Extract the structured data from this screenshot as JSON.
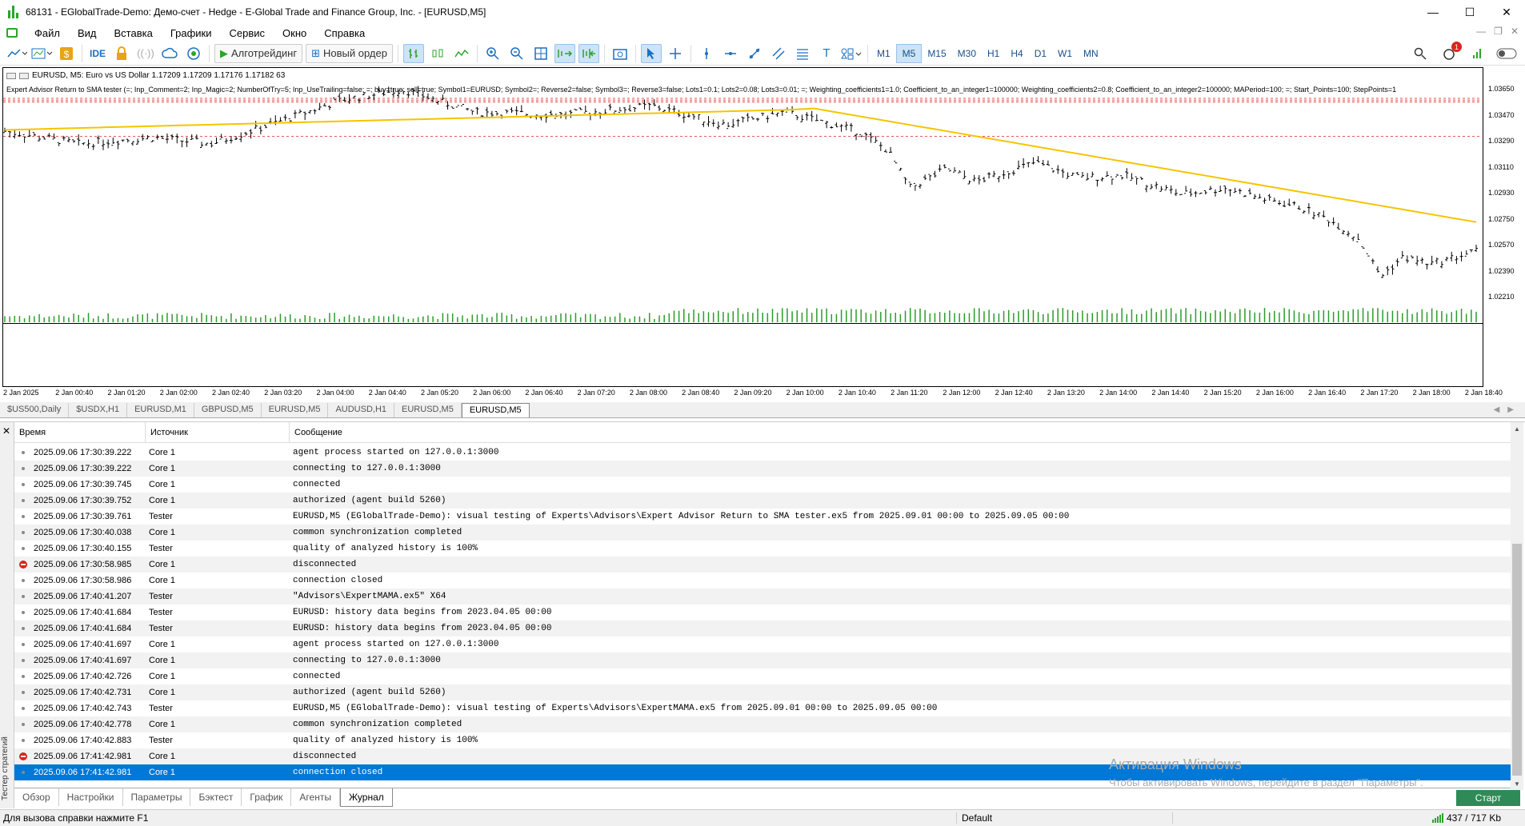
{
  "window": {
    "title": "68131 - EGlobalTrade-Demo: Демо-счет - Hedge - E-Global Trade and Finance Group, Inc. - [EURUSD,M5]",
    "minimize": "—",
    "maximize": "☐",
    "close": "✕"
  },
  "menu": {
    "items": [
      "Файл",
      "Вид",
      "Вставка",
      "Графики",
      "Сервис",
      "Окно",
      "Справка"
    ]
  },
  "toolbar": {
    "ide": "IDE",
    "algotrading": "Алготрейдинг",
    "new_order": "Новый ордер",
    "timeframes": [
      "M1",
      "M5",
      "M15",
      "M30",
      "H1",
      "H4",
      "D1",
      "W1",
      "MN"
    ],
    "active_timeframe": "M5",
    "notification_count": "1"
  },
  "chart": {
    "symbol_info": "EURUSD, M5:  Euro vs US Dollar  1.17209 1.17209 1.17176 1.17182  63",
    "ea_info": "Expert Advisor Return to SMA tester (=; Inp_Comment=2; Inp_Magic=2; NumberOfTry=5; Inp_UseTrailing=false; =; buy=true; sell=true; Symbol1=EURUSD; Symbol2=; Reverse2=false; Symbol3=; Reverse3=false; Lots1=0.1; Lots2=0.08; Lots3=0.01; =; Weighting_coefficients1=1.0; Coefficient_to_an_integer1=100000; Weighting_coefficients2=0.8; Coefficient_to_an_integer2=100000; MAPeriod=100; =; Start_Points=100; StepPoints=1",
    "price_labels": [
      "1.03650",
      "1.03470",
      "1.03290",
      "1.03110",
      "1.02930",
      "1.02750",
      "1.02570",
      "1.02390",
      "1.02210"
    ],
    "time_labels": [
      "2 Jan 2025",
      "2 Jan 00:40",
      "2 Jan 01:20",
      "2 Jan 02:00",
      "2 Jan 02:40",
      "2 Jan 03:20",
      "2 Jan 04:00",
      "2 Jan 04:40",
      "2 Jan 05:20",
      "2 Jan 06:00",
      "2 Jan 06:40",
      "2 Jan 07:20",
      "2 Jan 08:00",
      "2 Jan 08:40",
      "2 Jan 09:20",
      "2 Jan 10:00",
      "2 Jan 10:40",
      "2 Jan 11:20",
      "2 Jan 12:00",
      "2 Jan 12:40",
      "2 Jan 13:20",
      "2 Jan 14:00",
      "2 Jan 14:40",
      "2 Jan 15:20",
      "2 Jan 16:00",
      "2 Jan 16:40",
      "2 Jan 17:20",
      "2 Jan 18:00",
      "2 Jan 18:40"
    ],
    "ma_color": "#f5c400",
    "up_color": "#000000",
    "volume_color": "#2a9d2a"
  },
  "chart_tabs": [
    "$US500,Daily",
    "$USDX,H1",
    "EURUSD,M1",
    "GBPUSD,M5",
    "EURUSD,M5",
    "AUDUSD,H1",
    "EURUSD,M5",
    "EURUSD,M5"
  ],
  "chart_tab_active": 7,
  "log": {
    "columns": {
      "time": "Время",
      "source": "Источник",
      "message": "Сообщение"
    },
    "rows": [
      {
        "level": "info",
        "time": "2025.09.06 17:30:39.222",
        "source": "Core 1",
        "message": "agent process started on 127.0.0.1:3000"
      },
      {
        "level": "info",
        "time": "2025.09.06 17:30:39.222",
        "source": "Core 1",
        "message": "connecting to 127.0.0.1:3000"
      },
      {
        "level": "info",
        "time": "2025.09.06 17:30:39.745",
        "source": "Core 1",
        "message": "connected"
      },
      {
        "level": "info",
        "time": "2025.09.06 17:30:39.752",
        "source": "Core 1",
        "message": "authorized (agent build 5260)"
      },
      {
        "level": "info",
        "time": "2025.09.06 17:30:39.761",
        "source": "Tester",
        "message": "EURUSD,M5 (EGlobalTrade-Demo): visual testing of Experts\\Advisors\\Expert Advisor Return to SMA tester.ex5 from 2025.09.01 00:00 to 2025.09.05 00:00"
      },
      {
        "level": "info",
        "time": "2025.09.06 17:30:40.038",
        "source": "Core 1",
        "message": "common synchronization completed"
      },
      {
        "level": "info",
        "time": "2025.09.06 17:30:40.155",
        "source": "Tester",
        "message": "quality of analyzed history is 100%"
      },
      {
        "level": "error",
        "time": "2025.09.06 17:30:58.985",
        "source": "Core 1",
        "message": "disconnected"
      },
      {
        "level": "info",
        "time": "2025.09.06 17:30:58.986",
        "source": "Core 1",
        "message": "connection closed"
      },
      {
        "level": "info",
        "time": "2025.09.06 17:40:41.207",
        "source": "Tester",
        "message": "\"Advisors\\ExpertMAMA.ex5\" X64"
      },
      {
        "level": "info",
        "time": "2025.09.06 17:40:41.684",
        "source": "Tester",
        "message": "EURUSD: history data begins from 2023.04.05 00:00"
      },
      {
        "level": "info",
        "time": "2025.09.06 17:40:41.684",
        "source": "Tester",
        "message": "EURUSD: history data begins from 2023.04.05 00:00"
      },
      {
        "level": "info",
        "time": "2025.09.06 17:40:41.697",
        "source": "Core 1",
        "message": "agent process started on 127.0.0.1:3000"
      },
      {
        "level": "info",
        "time": "2025.09.06 17:40:41.697",
        "source": "Core 1",
        "message": "connecting to 127.0.0.1:3000"
      },
      {
        "level": "info",
        "time": "2025.09.06 17:40:42.726",
        "source": "Core 1",
        "message": "connected"
      },
      {
        "level": "info",
        "time": "2025.09.06 17:40:42.731",
        "source": "Core 1",
        "message": "authorized (agent build 5260)"
      },
      {
        "level": "info",
        "time": "2025.09.06 17:40:42.743",
        "source": "Tester",
        "message": "EURUSD,M5 (EGlobalTrade-Demo): visual testing of Experts\\Advisors\\ExpertMAMA.ex5 from 2025.09.01 00:00 to 2025.09.05 00:00"
      },
      {
        "level": "info",
        "time": "2025.09.06 17:40:42.778",
        "source": "Core 1",
        "message": "common synchronization completed"
      },
      {
        "level": "info",
        "time": "2025.09.06 17:40:42.883",
        "source": "Tester",
        "message": "quality of analyzed history is 100%"
      },
      {
        "level": "error",
        "time": "2025.09.06 17:41:42.981",
        "source": "Core 1",
        "message": "disconnected"
      },
      {
        "level": "info",
        "time": "2025.09.06 17:41:42.981",
        "source": "Core 1",
        "message": "connection closed"
      }
    ],
    "selected_row": 20
  },
  "side_label": "Тестер стратегий",
  "bottom_tabs": [
    "Обзор",
    "Настройки",
    "Параметры",
    "Бэктест",
    "График",
    "Агенты",
    "Журнал"
  ],
  "bottom_tab_active": 6,
  "start_button": "Старт",
  "watermark": {
    "line1": "Активация Windows",
    "line2": "Чтобы активировать Windows, перейдите в раздел \"Параметры\"."
  },
  "status": {
    "help": "Для вызова справки нажмите F1",
    "profile": "Default",
    "network": "437 / 717 Kb"
  }
}
